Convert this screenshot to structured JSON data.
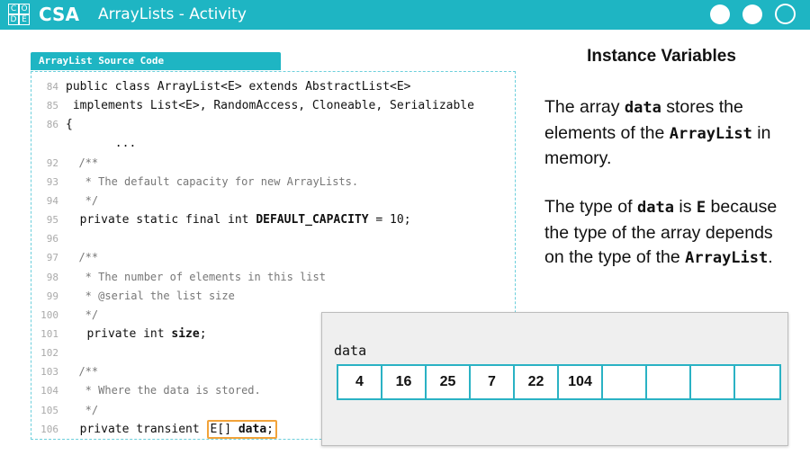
{
  "header": {
    "logo_letters": [
      "C",
      "O",
      "D",
      "E"
    ],
    "brand": "CSA",
    "title": "ArrayLists - Activity",
    "bg_color": "#1eb5c3"
  },
  "code_panel": {
    "tab_label": "ArrayList Source Code",
    "lines": [
      {
        "num": "84",
        "text": "public class ArrayList<E> extends AbstractList<E>"
      },
      {
        "num": "85",
        "text": " implements List<E>, RandomAccess, Cloneable, Serializable"
      },
      {
        "num": "86",
        "text": "{"
      },
      {
        "num": "",
        "text": "       ..."
      },
      {
        "num": "92",
        "text": "  /**"
      },
      {
        "num": "93",
        "text": "   * The default capacity for new ArrayLists."
      },
      {
        "num": "94",
        "text": "   */"
      },
      {
        "num": "95",
        "pre": "  private static final int ",
        "bold": "DEFAULT_CAPACITY",
        "post": " = 10;"
      },
      {
        "num": "96",
        "text": ""
      },
      {
        "num": "97",
        "text": "  /**"
      },
      {
        "num": "98",
        "text": "   * The number of elements in this list"
      },
      {
        "num": "99",
        "text": "   * @serial the list size"
      },
      {
        "num": "100",
        "text": "   */"
      },
      {
        "num": "101",
        "pre": "   private int ",
        "bold": "size",
        "post": ";"
      },
      {
        "num": "102",
        "text": ""
      },
      {
        "num": "103",
        "text": "  /**"
      },
      {
        "num": "104",
        "text": "   * Where the data is stored."
      },
      {
        "num": "105",
        "text": "   */"
      },
      {
        "num": "106",
        "pre": "  private transient ",
        "hl_type": "E[] ",
        "hl_bold": "data",
        "hl_post": ";"
      }
    ]
  },
  "right": {
    "heading": "Instance Variables",
    "p1": {
      "a": "The array ",
      "b": "data",
      "c": " stores the elements of the ",
      "d": "ArrayList",
      "e": " in memory."
    },
    "p2": {
      "a": "The type of ",
      "b": "data",
      "c": " is ",
      "d": "E",
      "e": " because the type of the array depends on the type of the ",
      "f": "ArrayList",
      "g": "."
    }
  },
  "array": {
    "label": "data",
    "cells": [
      "4",
      "16",
      "25",
      "7",
      "22",
      "104",
      "",
      "",
      "",
      ""
    ],
    "border_color": "#2ab2c4"
  }
}
